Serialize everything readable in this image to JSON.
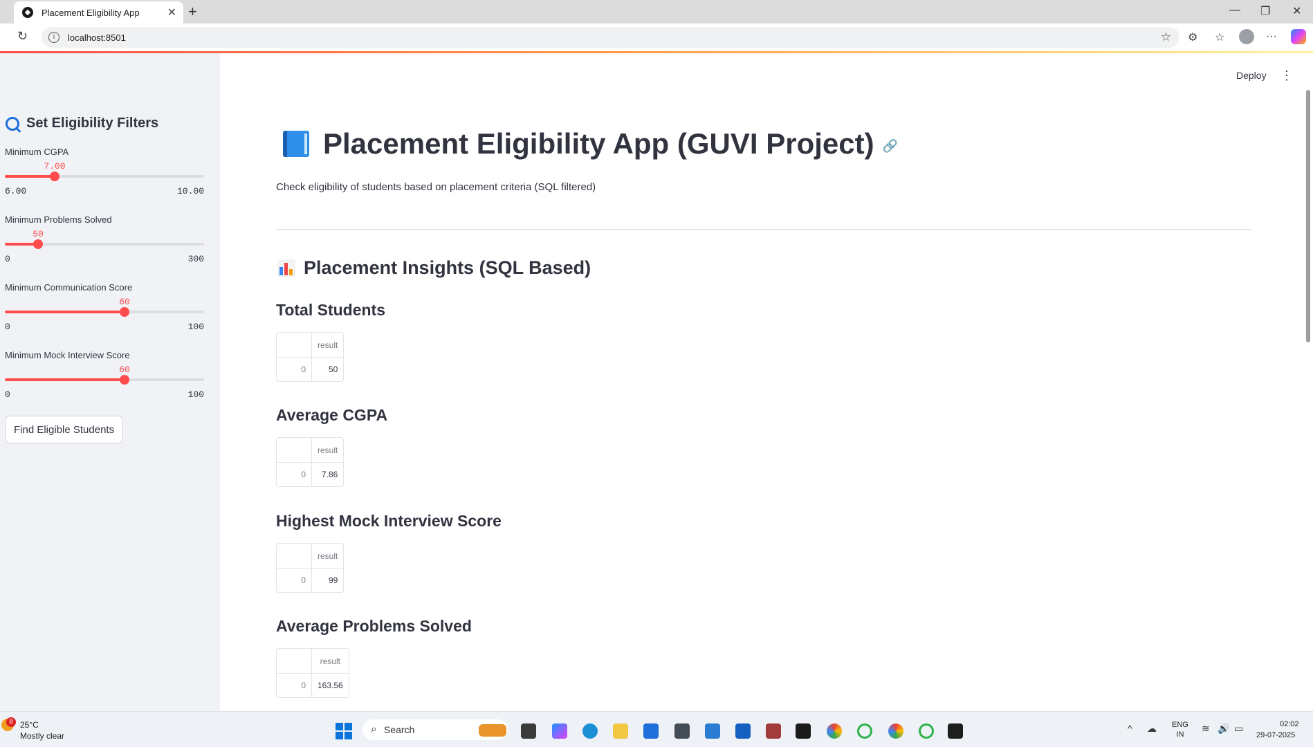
{
  "browser": {
    "tab_title": "Placement Eligibility App",
    "url": "localhost:8501"
  },
  "app": {
    "deploy_label": "Deploy",
    "title": "Placement Eligibility App (GUVI Project)",
    "subtitle": "Check eligibility of students based on placement criteria (SQL filtered)",
    "section_title": "Placement Insights (SQL Based)"
  },
  "sidebar": {
    "header": "Set Eligibility Filters",
    "sliders": [
      {
        "label": "Minimum CGPA",
        "value": "7.00",
        "min": "6.00",
        "max": "10.00",
        "fraction": 0.25
      },
      {
        "label": "Minimum Problems Solved",
        "value": "50",
        "min": "0",
        "max": "300",
        "fraction": 0.1667
      },
      {
        "label": "Minimum Communication Score",
        "value": "60",
        "min": "0",
        "max": "100",
        "fraction": 0.6
      },
      {
        "label": "Minimum Mock Interview Score",
        "value": "60",
        "min": "0",
        "max": "100",
        "fraction": 0.6
      }
    ],
    "button_label": "Find Eligible Students"
  },
  "metrics": [
    {
      "title": "Total Students",
      "header": "result",
      "index": "0",
      "value": "50"
    },
    {
      "title": "Average CGPA",
      "header": "result",
      "index": "0",
      "value": "7.86"
    },
    {
      "title": "Highest Mock Interview Score",
      "header": "result",
      "index": "0",
      "value": "99"
    },
    {
      "title": "Average Problems Solved",
      "header": "result",
      "index": "0",
      "value": "163.56"
    }
  ],
  "taskbar": {
    "weather_badge": "8",
    "temperature": "25°C",
    "weather": "Mostly clear",
    "search_label": "Search",
    "lang_top": "ENG",
    "lang_bottom": "IN",
    "time": "02:02",
    "date": "29-07-2025"
  }
}
